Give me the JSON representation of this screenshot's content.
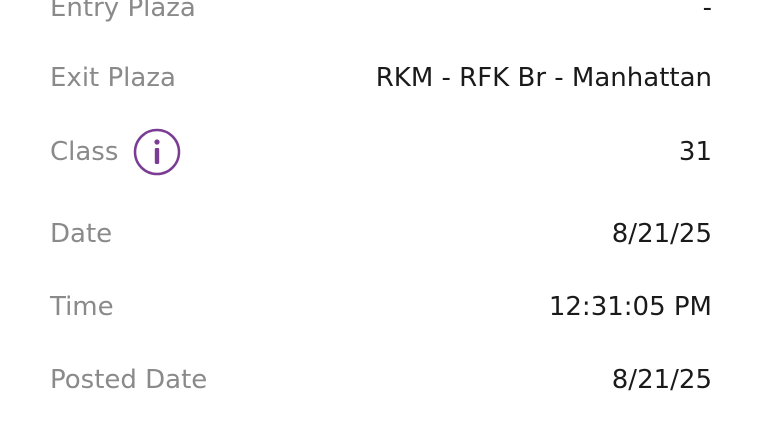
{
  "details": {
    "rows": [
      {
        "label": "Entry Plaza",
        "value": "-"
      },
      {
        "label": "Exit Plaza",
        "value": "RKM - RFK Br - Manhattan"
      },
      {
        "label": "Class",
        "value": "31",
        "has_info_icon": true,
        "icon": "info-icon"
      },
      {
        "label": "Date",
        "value": "8/21/25"
      },
      {
        "label": "Time",
        "value": "12:31:05 PM"
      },
      {
        "label": "Posted Date",
        "value": "8/21/25"
      }
    ]
  },
  "colors": {
    "label": "#8a8a8a",
    "value": "#1a1a1a",
    "info_accent": "#7b3d93",
    "background": "#ffffff"
  }
}
